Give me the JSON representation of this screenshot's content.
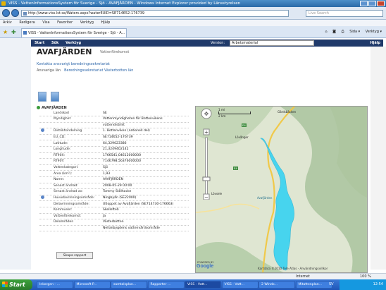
{
  "window": {
    "title": "VISS - VattenInformationsSystem för Sverige - Sjö - AVAFJÄRDEN - Windows Internet Explorer provided by Länsstyrelsen"
  },
  "browser": {
    "url": "http://www.viss.lst.se/Waters.aspx?waterEUID=SE714652-176739",
    "search_placeholder": "Live Search",
    "menu": [
      "Arkiv",
      "Redigera",
      "Visa",
      "Favoriter",
      "Verktyg",
      "Hjälp"
    ],
    "tab_title": "VISS - VattenInformationsSystem för Sverige - Sjö - A...",
    "tab_tools": [
      "Sida ▾",
      "Verktyg ▾"
    ]
  },
  "app": {
    "nav": [
      "Start",
      "Sök",
      "Verktyg"
    ],
    "version_label": "Version:",
    "version_value": "Arbetsmaterial",
    "help": "Hjälp",
    "page_title": "AVAFJÄRDEN",
    "page_subtitle": "Vattenförekomst",
    "contact_link": "Kontakta ansvarigt beredningssekretariat",
    "county_label": "Ansvariga län",
    "county_value": "Beredningssekretariat Västerbotten län",
    "section_header": "AVAFJÄRDEN",
    "report_button": "Skapa rapport"
  },
  "details": [
    {
      "label": "Landskod",
      "value": "SE"
    },
    {
      "label": "Myndighet",
      "value": "Vattenmyndigheten för Bottenvikens"
    },
    {
      "label": "",
      "value": "vattendistrikt"
    },
    {
      "label": "Distriktsindelning",
      "value": "1. Bottenviken (nationell del)"
    },
    {
      "label": "EU_CD:",
      "value": "SE714652-176739"
    },
    {
      "label": "Latitude:",
      "value": "64,329023386"
    },
    {
      "label": "Longitude:",
      "value": "21,3249402142"
    },
    {
      "label": "RT90X:",
      "value": "1766541,04612000000"
    },
    {
      "label": "RT90Y:",
      "value": "7146798,56376000000"
    },
    {
      "label": "Vattenkategori:",
      "value": "Sjö"
    },
    {
      "label": "Area (km²):",
      "value": "1,93"
    },
    {
      "label": "Namn:",
      "value": "AVAFJÄRDEN"
    },
    {
      "label": "Senast ändrad:",
      "value": "2008-05-29 00:00"
    },
    {
      "label": "Senast ändrad av:",
      "value": "Tommy Stålhacke"
    },
    {
      "label": "Huvudavrinningsområde:",
      "value": "Ningbyån (SE22000)"
    },
    {
      "label": "Delavrinningsområde:",
      "value": "Utloppet av Avafjärden (SE714730-176663)"
    },
    {
      "label": "Kommuner:",
      "value": "Skellefteå"
    },
    {
      "label": "Vattenförekomst:",
      "value": "Ja"
    },
    {
      "label": "Delområden",
      "value": "Västerbotten"
    },
    {
      "label": "",
      "value": "Nellanbygdens vattenvårdsområde"
    }
  ],
  "map": {
    "scale_top": "1 mi",
    "scale_bottom": "2 km",
    "road_label": "E4",
    "road_label_2": "E4",
    "place_1": "Lövånger",
    "place_2": "Lövsele",
    "place_3": "Avafjärden",
    "place_4": "Gärdsbäcken",
    "copyright": "Kartdata ©2010 Tele Atlas - Användningsvillkor",
    "powered": "POWERED BY",
    "google": "Google",
    "colors": {
      "lake": "#47d4ee",
      "forest": "#b2c9a6",
      "land": "#dfe6d2"
    }
  },
  "status": {
    "zone": "Internet",
    "zoom": "100 %"
  },
  "taskbar": {
    "start": "Start",
    "tasks": [
      "Inkorgen - ...",
      "Microsoft P...",
      "samtalsplan...",
      "Rapporter ...",
      "VISS - Vatt...",
      "VISS - Vatt...",
      "2 Windo...",
      "Mitattenplan..."
    ],
    "lang": "SV",
    "clock": "12:54"
  }
}
